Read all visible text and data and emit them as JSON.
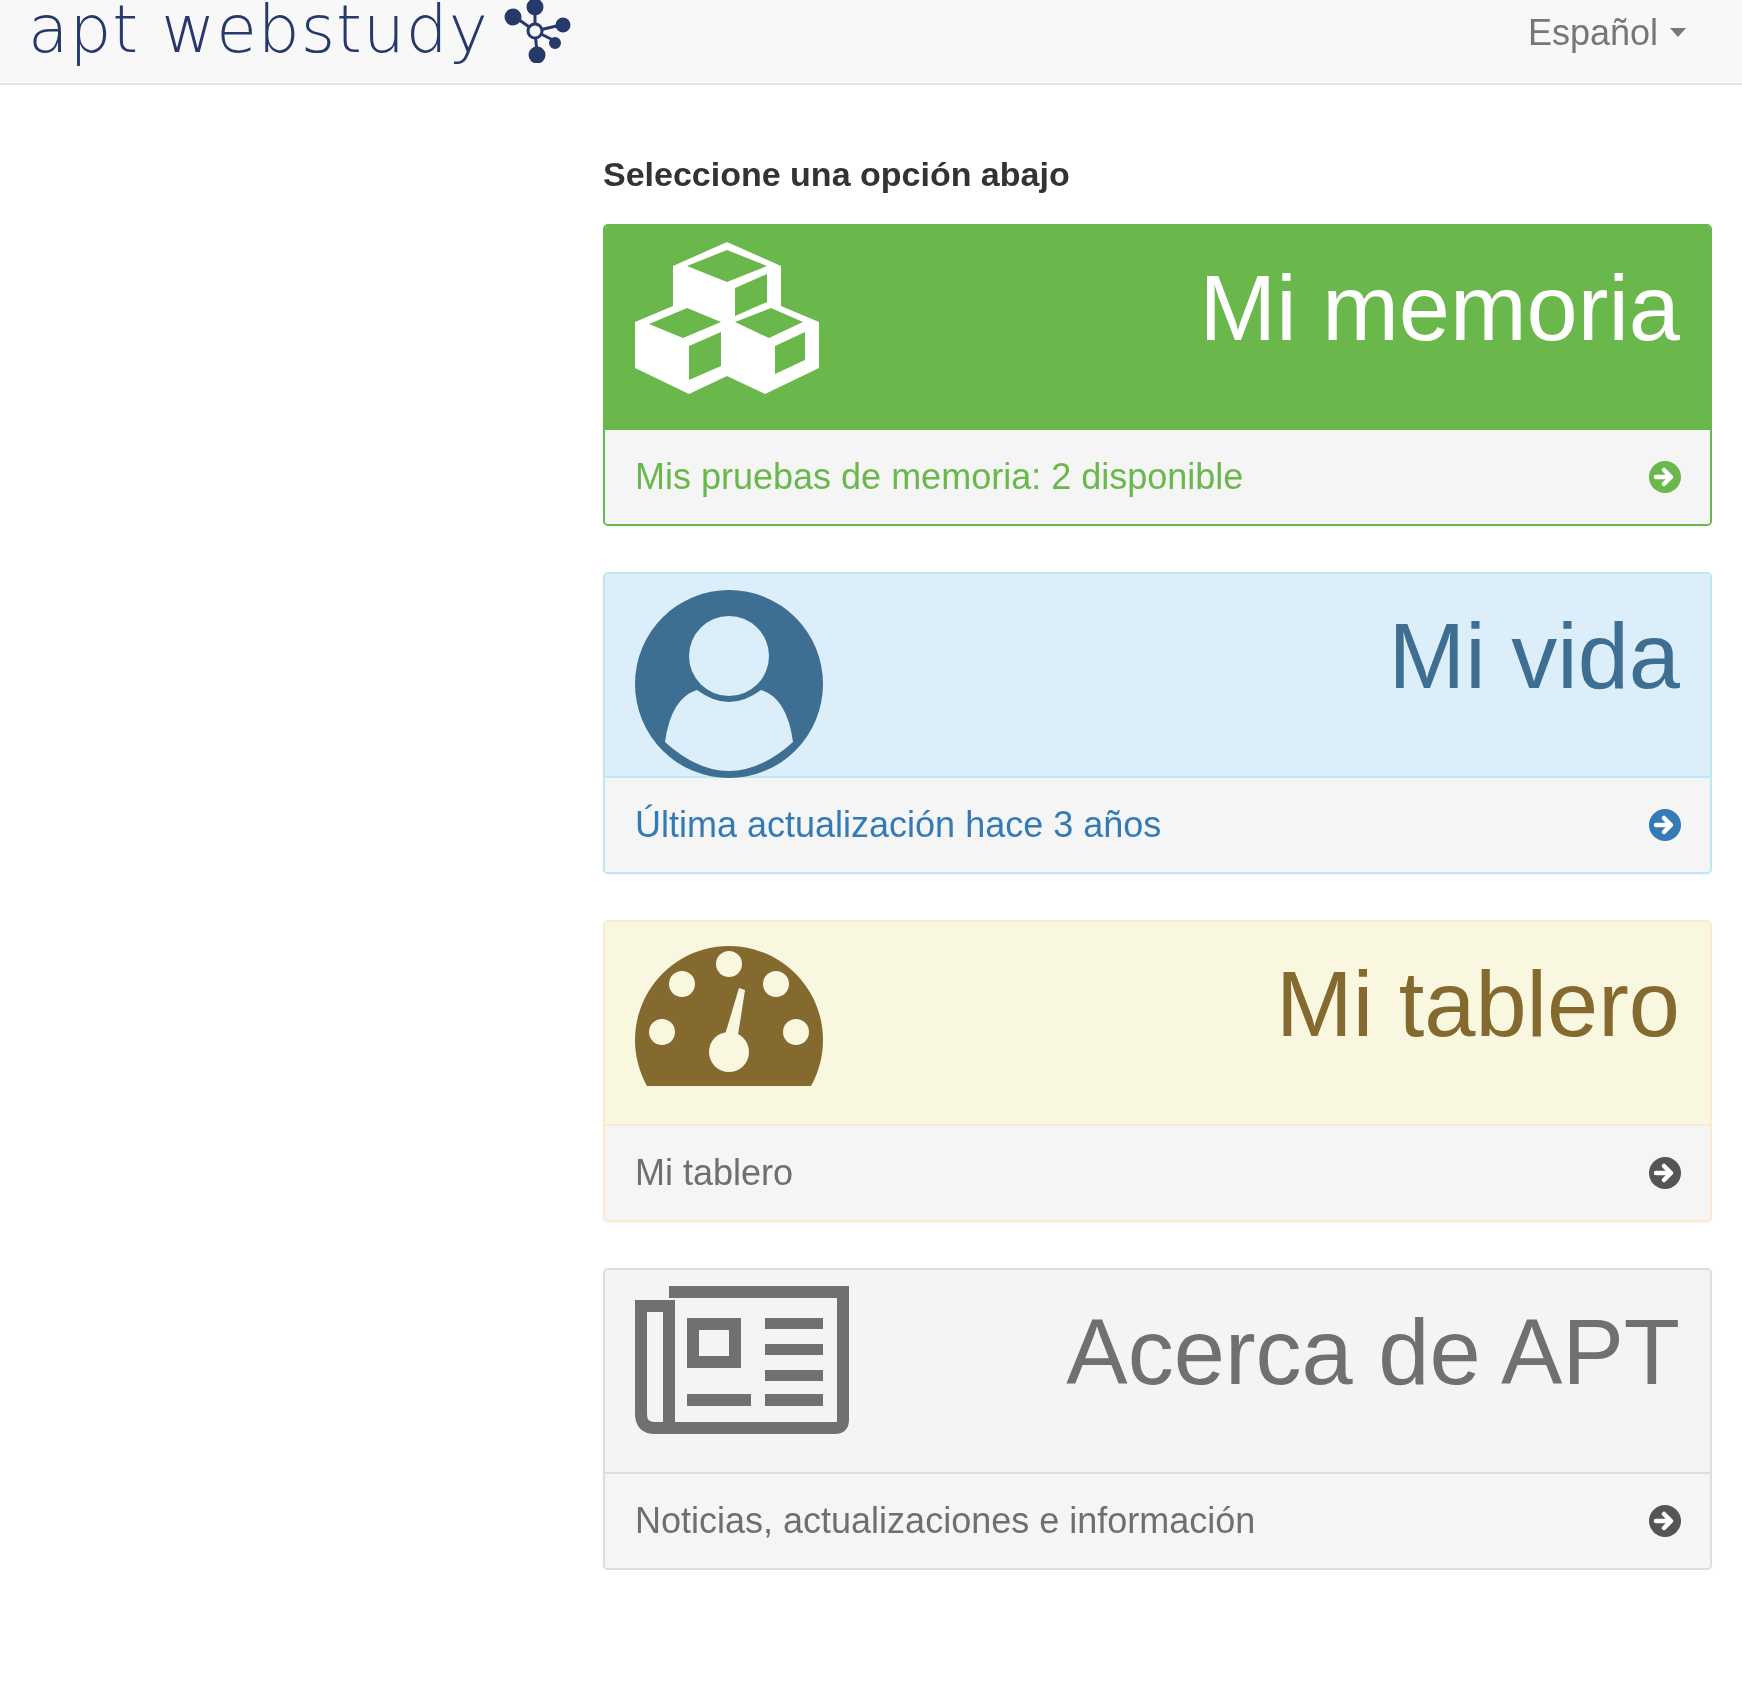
{
  "header": {
    "logo": "apt webstudy",
    "language": "Español"
  },
  "heading": "Seleccione una opción abajo",
  "panels": [
    {
      "kind": "memory",
      "title": "Mi memoria",
      "footer": "Mis pruebas de memoria: 2 disponible"
    },
    {
      "kind": "life",
      "title": "Mi vida",
      "footer": "Última actualización hace 3 años"
    },
    {
      "kind": "dashboard",
      "title": "Mi tablero",
      "footer": "Mi tablero"
    },
    {
      "kind": "about",
      "title": "Acerca de APT",
      "footer": "Noticias, actualizaciones e información"
    }
  ]
}
